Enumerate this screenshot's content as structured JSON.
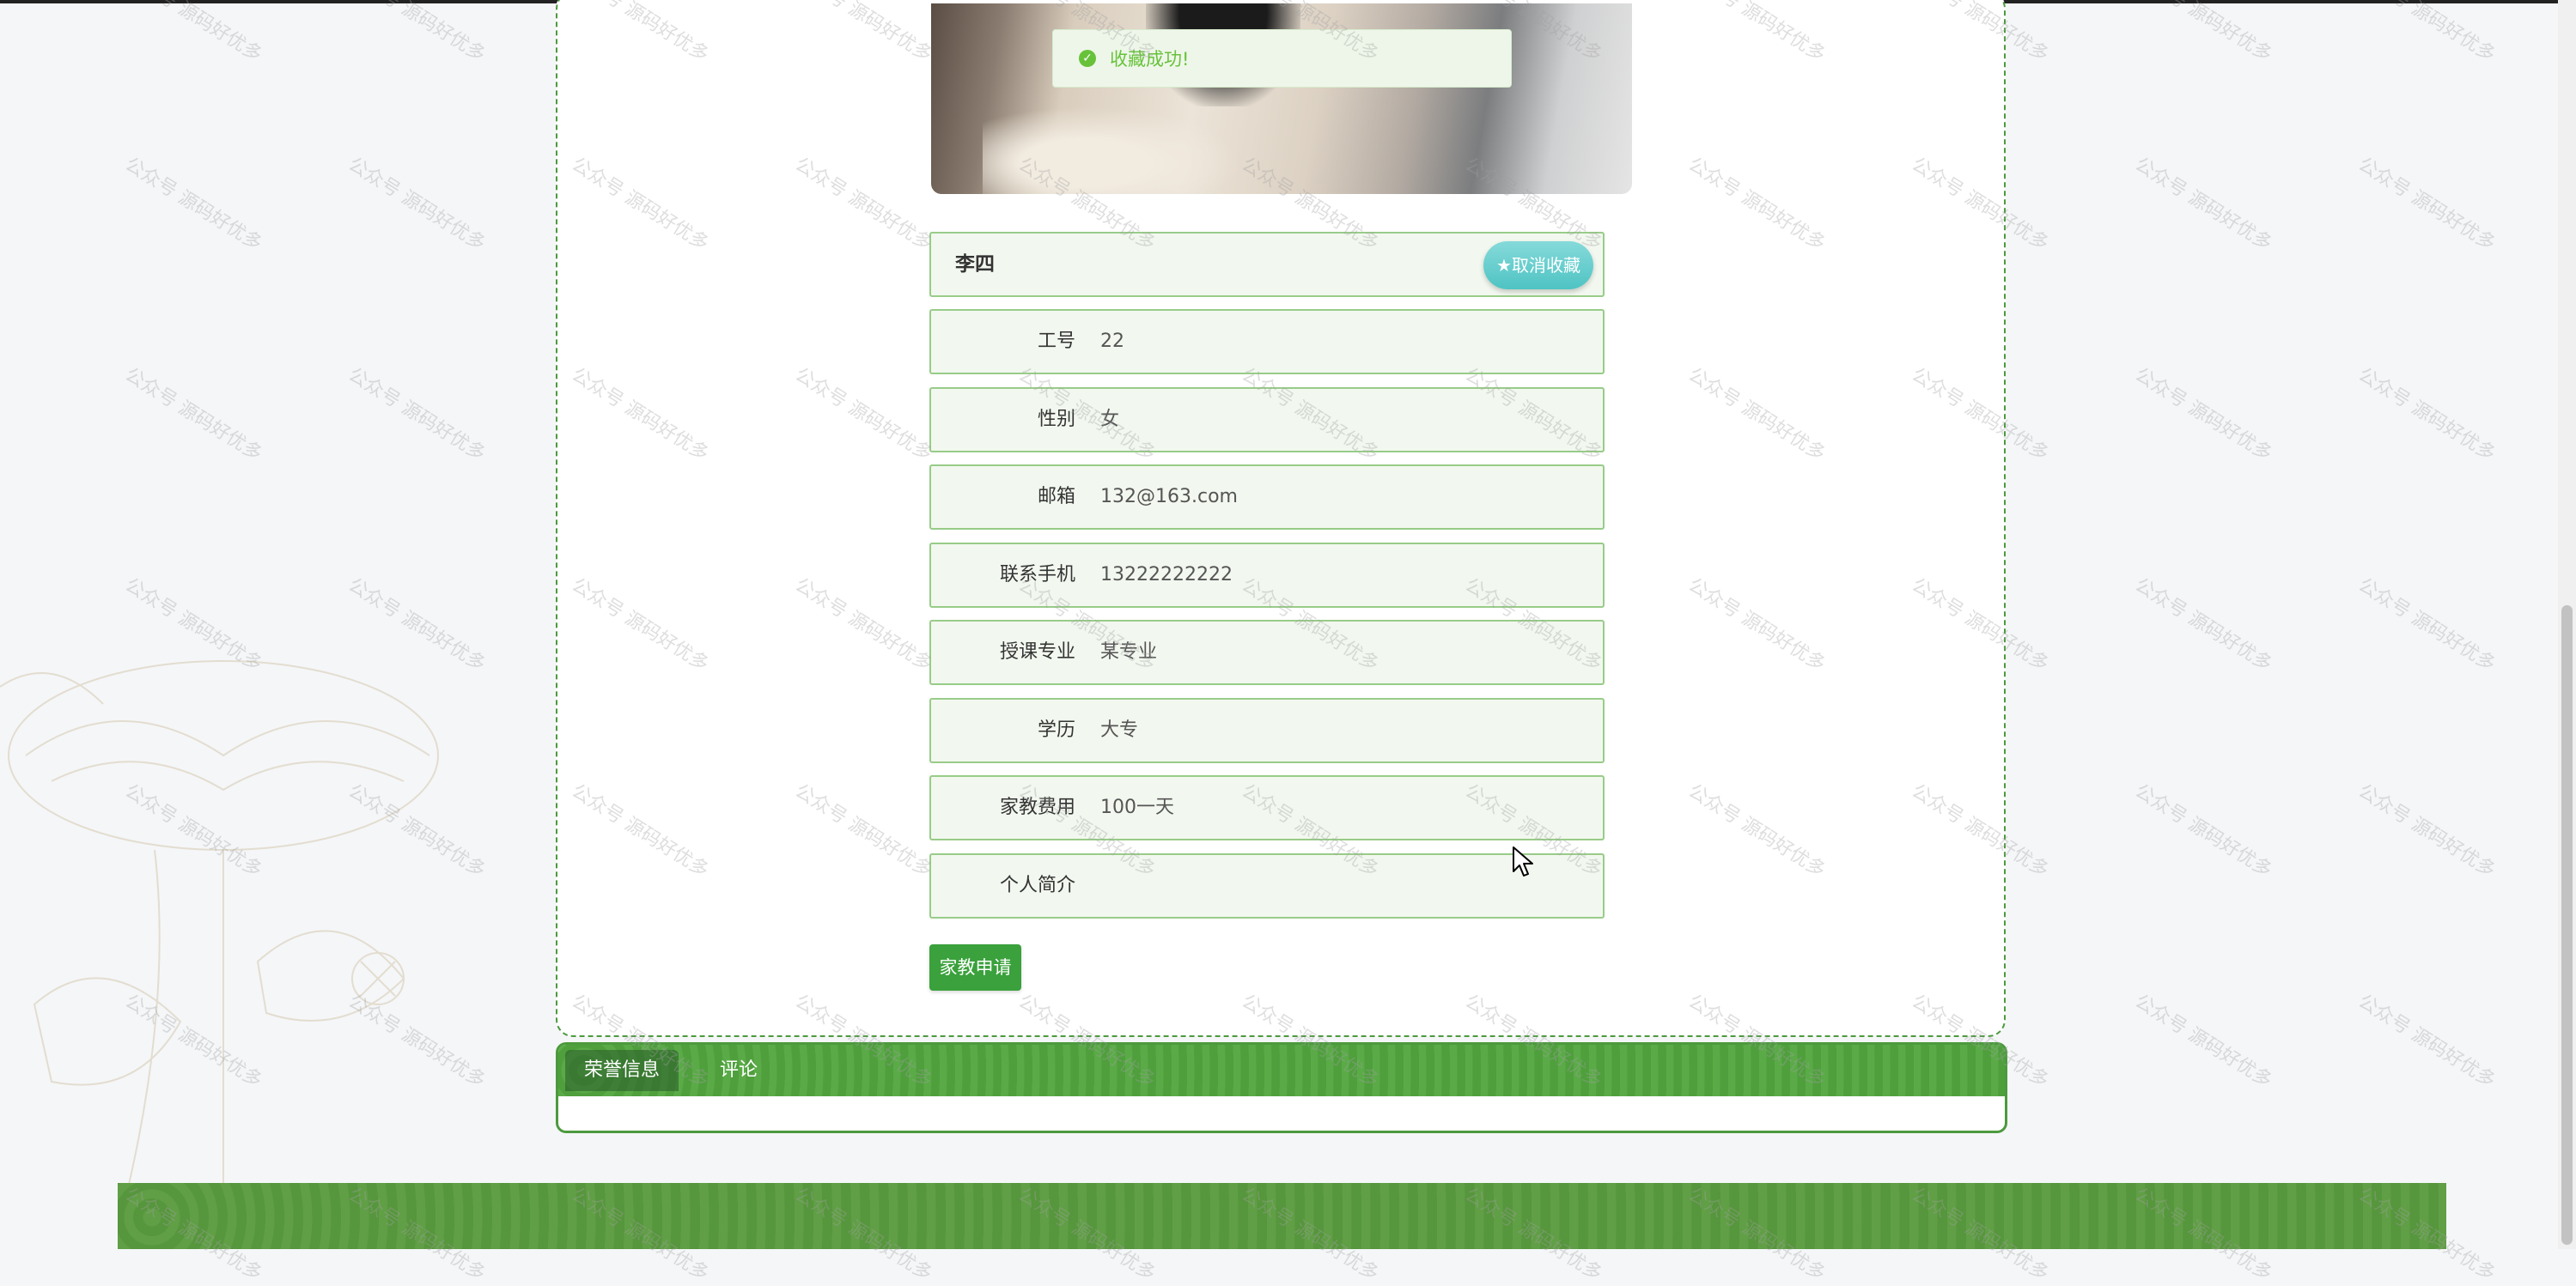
{
  "toast": {
    "message": "收藏成功!"
  },
  "teacher": {
    "name": "李四",
    "favorite_button": "★取消收藏",
    "fields": [
      {
        "label": "工号",
        "value": "22"
      },
      {
        "label": "性别",
        "value": "女"
      },
      {
        "label": "邮箱",
        "value": "132@163.com"
      },
      {
        "label": "联系手机",
        "value": "13222222222"
      },
      {
        "label": "授课专业",
        "value": "某专业"
      },
      {
        "label": "学历",
        "value": "大专"
      },
      {
        "label": "家教费用",
        "value": "100一天"
      },
      {
        "label": "个人简介",
        "value": ""
      }
    ]
  },
  "actions": {
    "apply_label": "家教申请"
  },
  "tabs": [
    {
      "label": "荣誉信息",
      "active": true
    },
    {
      "label": "评论",
      "active": false
    }
  ],
  "watermark_text": "公众号 源码好优多",
  "colors": {
    "primary_green": "#3aa13c",
    "border_green": "#4c9a3d",
    "favorite_teal": "#4fc3c3",
    "toast_green": "#67c23a"
  }
}
